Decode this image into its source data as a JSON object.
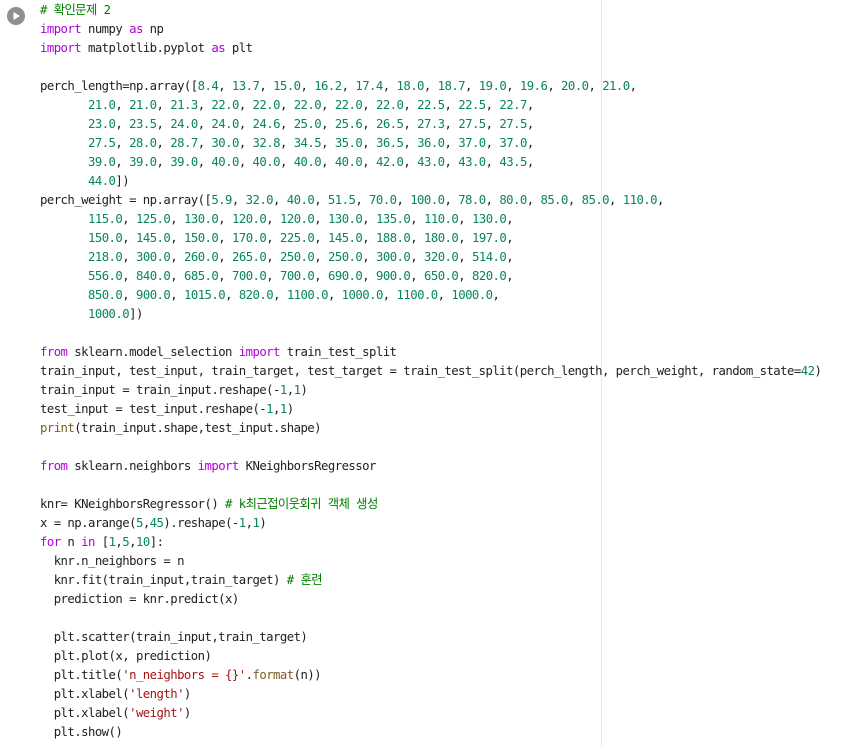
{
  "run_button": {
    "icon": "play-icon"
  },
  "code_lines": [
    [
      [
        "com",
        "# 확인문제 2"
      ]
    ],
    [
      [
        "kw",
        "import"
      ],
      [
        "txt",
        " numpy "
      ],
      [
        "kw",
        "as"
      ],
      [
        "txt",
        " np"
      ]
    ],
    [
      [
        "kw",
        "import"
      ],
      [
        "txt",
        " matplotlib.pyplot "
      ],
      [
        "kw",
        "as"
      ],
      [
        "txt",
        " plt"
      ]
    ],
    [],
    [
      [
        "txt",
        "perch_length=np.array(["
      ],
      [
        "num",
        "8.4"
      ],
      [
        "txt",
        ", "
      ],
      [
        "num",
        "13.7"
      ],
      [
        "txt",
        ", "
      ],
      [
        "num",
        "15.0"
      ],
      [
        "txt",
        ", "
      ],
      [
        "num",
        "16.2"
      ],
      [
        "txt",
        ", "
      ],
      [
        "num",
        "17.4"
      ],
      [
        "txt",
        ", "
      ],
      [
        "num",
        "18.0"
      ],
      [
        "txt",
        ", "
      ],
      [
        "num",
        "18.7"
      ],
      [
        "txt",
        ", "
      ],
      [
        "num",
        "19.0"
      ],
      [
        "txt",
        ", "
      ],
      [
        "num",
        "19.6"
      ],
      [
        "txt",
        ", "
      ],
      [
        "num",
        "20.0"
      ],
      [
        "txt",
        ", "
      ],
      [
        "num",
        "21.0"
      ],
      [
        "txt",
        ","
      ]
    ],
    [
      [
        "txt",
        "       "
      ],
      [
        "num",
        "21.0"
      ],
      [
        "txt",
        ", "
      ],
      [
        "num",
        "21.0"
      ],
      [
        "txt",
        ", "
      ],
      [
        "num",
        "21.3"
      ],
      [
        "txt",
        ", "
      ],
      [
        "num",
        "22.0"
      ],
      [
        "txt",
        ", "
      ],
      [
        "num",
        "22.0"
      ],
      [
        "txt",
        ", "
      ],
      [
        "num",
        "22.0"
      ],
      [
        "txt",
        ", "
      ],
      [
        "num",
        "22.0"
      ],
      [
        "txt",
        ", "
      ],
      [
        "num",
        "22.0"
      ],
      [
        "txt",
        ", "
      ],
      [
        "num",
        "22.5"
      ],
      [
        "txt",
        ", "
      ],
      [
        "num",
        "22.5"
      ],
      [
        "txt",
        ", "
      ],
      [
        "num",
        "22.7"
      ],
      [
        "txt",
        ","
      ]
    ],
    [
      [
        "txt",
        "       "
      ],
      [
        "num",
        "23.0"
      ],
      [
        "txt",
        ", "
      ],
      [
        "num",
        "23.5"
      ],
      [
        "txt",
        ", "
      ],
      [
        "num",
        "24.0"
      ],
      [
        "txt",
        ", "
      ],
      [
        "num",
        "24.0"
      ],
      [
        "txt",
        ", "
      ],
      [
        "num",
        "24.6"
      ],
      [
        "txt",
        ", "
      ],
      [
        "num",
        "25.0"
      ],
      [
        "txt",
        ", "
      ],
      [
        "num",
        "25.6"
      ],
      [
        "txt",
        ", "
      ],
      [
        "num",
        "26.5"
      ],
      [
        "txt",
        ", "
      ],
      [
        "num",
        "27.3"
      ],
      [
        "txt",
        ", "
      ],
      [
        "num",
        "27.5"
      ],
      [
        "txt",
        ", "
      ],
      [
        "num",
        "27.5"
      ],
      [
        "txt",
        ","
      ]
    ],
    [
      [
        "txt",
        "       "
      ],
      [
        "num",
        "27.5"
      ],
      [
        "txt",
        ", "
      ],
      [
        "num",
        "28.0"
      ],
      [
        "txt",
        ", "
      ],
      [
        "num",
        "28.7"
      ],
      [
        "txt",
        ", "
      ],
      [
        "num",
        "30.0"
      ],
      [
        "txt",
        ", "
      ],
      [
        "num",
        "32.8"
      ],
      [
        "txt",
        ", "
      ],
      [
        "num",
        "34.5"
      ],
      [
        "txt",
        ", "
      ],
      [
        "num",
        "35.0"
      ],
      [
        "txt",
        ", "
      ],
      [
        "num",
        "36.5"
      ],
      [
        "txt",
        ", "
      ],
      [
        "num",
        "36.0"
      ],
      [
        "txt",
        ", "
      ],
      [
        "num",
        "37.0"
      ],
      [
        "txt",
        ", "
      ],
      [
        "num",
        "37.0"
      ],
      [
        "txt",
        ","
      ]
    ],
    [
      [
        "txt",
        "       "
      ],
      [
        "num",
        "39.0"
      ],
      [
        "txt",
        ", "
      ],
      [
        "num",
        "39.0"
      ],
      [
        "txt",
        ", "
      ],
      [
        "num",
        "39.0"
      ],
      [
        "txt",
        ", "
      ],
      [
        "num",
        "40.0"
      ],
      [
        "txt",
        ", "
      ],
      [
        "num",
        "40.0"
      ],
      [
        "txt",
        ", "
      ],
      [
        "num",
        "40.0"
      ],
      [
        "txt",
        ", "
      ],
      [
        "num",
        "40.0"
      ],
      [
        "txt",
        ", "
      ],
      [
        "num",
        "42.0"
      ],
      [
        "txt",
        ", "
      ],
      [
        "num",
        "43.0"
      ],
      [
        "txt",
        ", "
      ],
      [
        "num",
        "43.0"
      ],
      [
        "txt",
        ", "
      ],
      [
        "num",
        "43.5"
      ],
      [
        "txt",
        ","
      ]
    ],
    [
      [
        "txt",
        "       "
      ],
      [
        "num",
        "44.0"
      ],
      [
        "txt",
        "])"
      ]
    ],
    [
      [
        "txt",
        "perch_weight = np.array(["
      ],
      [
        "num",
        "5.9"
      ],
      [
        "txt",
        ", "
      ],
      [
        "num",
        "32.0"
      ],
      [
        "txt",
        ", "
      ],
      [
        "num",
        "40.0"
      ],
      [
        "txt",
        ", "
      ],
      [
        "num",
        "51.5"
      ],
      [
        "txt",
        ", "
      ],
      [
        "num",
        "70.0"
      ],
      [
        "txt",
        ", "
      ],
      [
        "num",
        "100.0"
      ],
      [
        "txt",
        ", "
      ],
      [
        "num",
        "78.0"
      ],
      [
        "txt",
        ", "
      ],
      [
        "num",
        "80.0"
      ],
      [
        "txt",
        ", "
      ],
      [
        "num",
        "85.0"
      ],
      [
        "txt",
        ", "
      ],
      [
        "num",
        "85.0"
      ],
      [
        "txt",
        ", "
      ],
      [
        "num",
        "110.0"
      ],
      [
        "txt",
        ","
      ]
    ],
    [
      [
        "txt",
        "       "
      ],
      [
        "num",
        "115.0"
      ],
      [
        "txt",
        ", "
      ],
      [
        "num",
        "125.0"
      ],
      [
        "txt",
        ", "
      ],
      [
        "num",
        "130.0"
      ],
      [
        "txt",
        ", "
      ],
      [
        "num",
        "120.0"
      ],
      [
        "txt",
        ", "
      ],
      [
        "num",
        "120.0"
      ],
      [
        "txt",
        ", "
      ],
      [
        "num",
        "130.0"
      ],
      [
        "txt",
        ", "
      ],
      [
        "num",
        "135.0"
      ],
      [
        "txt",
        ", "
      ],
      [
        "num",
        "110.0"
      ],
      [
        "txt",
        ", "
      ],
      [
        "num",
        "130.0"
      ],
      [
        "txt",
        ","
      ]
    ],
    [
      [
        "txt",
        "       "
      ],
      [
        "num",
        "150.0"
      ],
      [
        "txt",
        ", "
      ],
      [
        "num",
        "145.0"
      ],
      [
        "txt",
        ", "
      ],
      [
        "num",
        "150.0"
      ],
      [
        "txt",
        ", "
      ],
      [
        "num",
        "170.0"
      ],
      [
        "txt",
        ", "
      ],
      [
        "num",
        "225.0"
      ],
      [
        "txt",
        ", "
      ],
      [
        "num",
        "145.0"
      ],
      [
        "txt",
        ", "
      ],
      [
        "num",
        "188.0"
      ],
      [
        "txt",
        ", "
      ],
      [
        "num",
        "180.0"
      ],
      [
        "txt",
        ", "
      ],
      [
        "num",
        "197.0"
      ],
      [
        "txt",
        ","
      ]
    ],
    [
      [
        "txt",
        "       "
      ],
      [
        "num",
        "218.0"
      ],
      [
        "txt",
        ", "
      ],
      [
        "num",
        "300.0"
      ],
      [
        "txt",
        ", "
      ],
      [
        "num",
        "260.0"
      ],
      [
        "txt",
        ", "
      ],
      [
        "num",
        "265.0"
      ],
      [
        "txt",
        ", "
      ],
      [
        "num",
        "250.0"
      ],
      [
        "txt",
        ", "
      ],
      [
        "num",
        "250.0"
      ],
      [
        "txt",
        ", "
      ],
      [
        "num",
        "300.0"
      ],
      [
        "txt",
        ", "
      ],
      [
        "num",
        "320.0"
      ],
      [
        "txt",
        ", "
      ],
      [
        "num",
        "514.0"
      ],
      [
        "txt",
        ","
      ]
    ],
    [
      [
        "txt",
        "       "
      ],
      [
        "num",
        "556.0"
      ],
      [
        "txt",
        ", "
      ],
      [
        "num",
        "840.0"
      ],
      [
        "txt",
        ", "
      ],
      [
        "num",
        "685.0"
      ],
      [
        "txt",
        ", "
      ],
      [
        "num",
        "700.0"
      ],
      [
        "txt",
        ", "
      ],
      [
        "num",
        "700.0"
      ],
      [
        "txt",
        ", "
      ],
      [
        "num",
        "690.0"
      ],
      [
        "txt",
        ", "
      ],
      [
        "num",
        "900.0"
      ],
      [
        "txt",
        ", "
      ],
      [
        "num",
        "650.0"
      ],
      [
        "txt",
        ", "
      ],
      [
        "num",
        "820.0"
      ],
      [
        "txt",
        ","
      ]
    ],
    [
      [
        "txt",
        "       "
      ],
      [
        "num",
        "850.0"
      ],
      [
        "txt",
        ", "
      ],
      [
        "num",
        "900.0"
      ],
      [
        "txt",
        ", "
      ],
      [
        "num",
        "1015.0"
      ],
      [
        "txt",
        ", "
      ],
      [
        "num",
        "820.0"
      ],
      [
        "txt",
        ", "
      ],
      [
        "num",
        "1100.0"
      ],
      [
        "txt",
        ", "
      ],
      [
        "num",
        "1000.0"
      ],
      [
        "txt",
        ", "
      ],
      [
        "num",
        "1100.0"
      ],
      [
        "txt",
        ", "
      ],
      [
        "num",
        "1000.0"
      ],
      [
        "txt",
        ","
      ]
    ],
    [
      [
        "txt",
        "       "
      ],
      [
        "num",
        "1000.0"
      ],
      [
        "txt",
        "])"
      ]
    ],
    [],
    [
      [
        "kw",
        "from"
      ],
      [
        "txt",
        " sklearn.model_selection "
      ],
      [
        "kw",
        "import"
      ],
      [
        "txt",
        " train_test_split"
      ]
    ],
    [
      [
        "txt",
        "train_input, test_input, train_target, test_target = train_test_split(perch_length, perch_weight, random_state="
      ],
      [
        "num",
        "42"
      ],
      [
        "txt",
        ")"
      ]
    ],
    [
      [
        "txt",
        "train_input = train_input.reshape(-"
      ],
      [
        "num",
        "1"
      ],
      [
        "txt",
        ","
      ],
      [
        "num",
        "1"
      ],
      [
        "txt",
        ")"
      ]
    ],
    [
      [
        "txt",
        "test_input = test_input.reshape(-"
      ],
      [
        "num",
        "1"
      ],
      [
        "txt",
        ","
      ],
      [
        "num",
        "1"
      ],
      [
        "txt",
        ")"
      ]
    ],
    [
      [
        "fn",
        "print"
      ],
      [
        "txt",
        "(train_input.shape,test_input.shape)"
      ]
    ],
    [],
    [
      [
        "kw",
        "from"
      ],
      [
        "txt",
        " sklearn.neighbors "
      ],
      [
        "kw",
        "import"
      ],
      [
        "txt",
        " KNeighborsRegressor"
      ]
    ],
    [],
    [
      [
        "txt",
        "knr= KNeighborsRegressor() "
      ],
      [
        "com",
        "# k최근접이웃회귀 객체 생성"
      ]
    ],
    [
      [
        "txt",
        "x = np.arange("
      ],
      [
        "num",
        "5"
      ],
      [
        "txt",
        ","
      ],
      [
        "num",
        "45"
      ],
      [
        "txt",
        ").reshape(-"
      ],
      [
        "num",
        "1"
      ],
      [
        "txt",
        ","
      ],
      [
        "num",
        "1"
      ],
      [
        "txt",
        ")"
      ]
    ],
    [
      [
        "kw",
        "for"
      ],
      [
        "txt",
        " n "
      ],
      [
        "kw",
        "in"
      ],
      [
        "txt",
        " ["
      ],
      [
        "num",
        "1"
      ],
      [
        "txt",
        ","
      ],
      [
        "num",
        "5"
      ],
      [
        "txt",
        ","
      ],
      [
        "num",
        "10"
      ],
      [
        "txt",
        "]:"
      ]
    ],
    [
      [
        "txt",
        "  knr.n_neighbors = n"
      ]
    ],
    [
      [
        "txt",
        "  knr.fit(train_input,train_target) "
      ],
      [
        "com",
        "# 훈련"
      ]
    ],
    [
      [
        "txt",
        "  prediction = knr.predict(x)"
      ]
    ],
    [],
    [
      [
        "txt",
        "  plt.scatter(train_input,train_target)"
      ]
    ],
    [
      [
        "txt",
        "  plt.plot(x, prediction)"
      ]
    ],
    [
      [
        "txt",
        "  plt.title("
      ],
      [
        "str",
        "'n_neighbors = {}'"
      ],
      [
        "txt",
        "."
      ],
      [
        "fn",
        "format"
      ],
      [
        "txt",
        "(n))"
      ]
    ],
    [
      [
        "txt",
        "  plt.xlabel("
      ],
      [
        "str",
        "'length'"
      ],
      [
        "txt",
        ")"
      ]
    ],
    [
      [
        "txt",
        "  plt.xlabel("
      ],
      [
        "str",
        "'weight'"
      ],
      [
        "txt",
        ")"
      ]
    ],
    [
      [
        "txt",
        "  plt.show()"
      ]
    ]
  ]
}
